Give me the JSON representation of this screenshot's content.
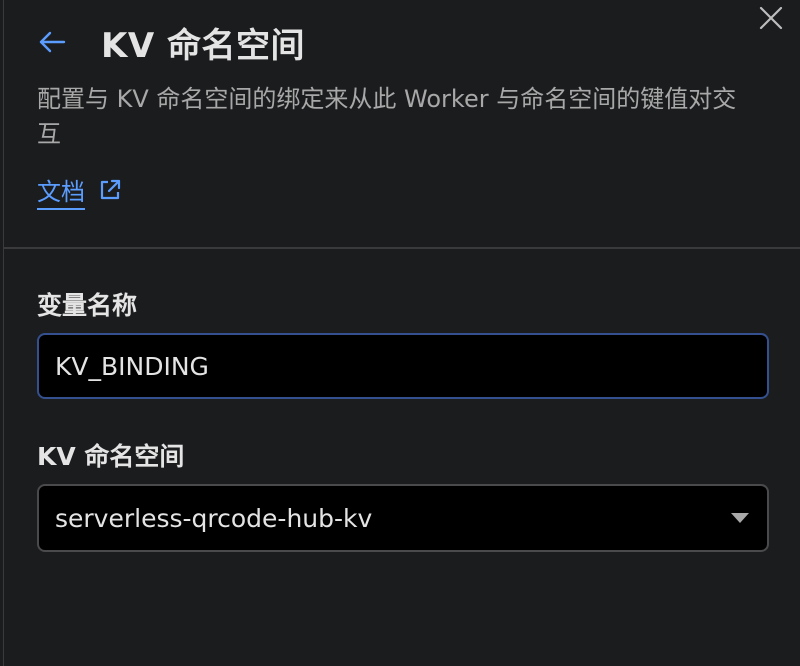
{
  "dialog": {
    "title": "KV 命名空间",
    "description": "配置与 KV 命名空间的绑定来从此 Worker 与命名空间的键值对交互",
    "docs_link_label": "文档"
  },
  "form": {
    "variable_name_label": "变量名称",
    "variable_name_value": "KV_BINDING",
    "namespace_label": "KV 命名空间",
    "namespace_selected": "serverless-qrcode-hub-kv"
  },
  "icons": {
    "back": "arrow-left-icon",
    "close": "close-icon",
    "external": "external-link-icon",
    "dropdown": "chevron-down-icon"
  },
  "colors": {
    "background": "#1b1c1e",
    "accent": "#5b9dff",
    "input_focus_border": "#35508f",
    "input_background": "#000000"
  }
}
